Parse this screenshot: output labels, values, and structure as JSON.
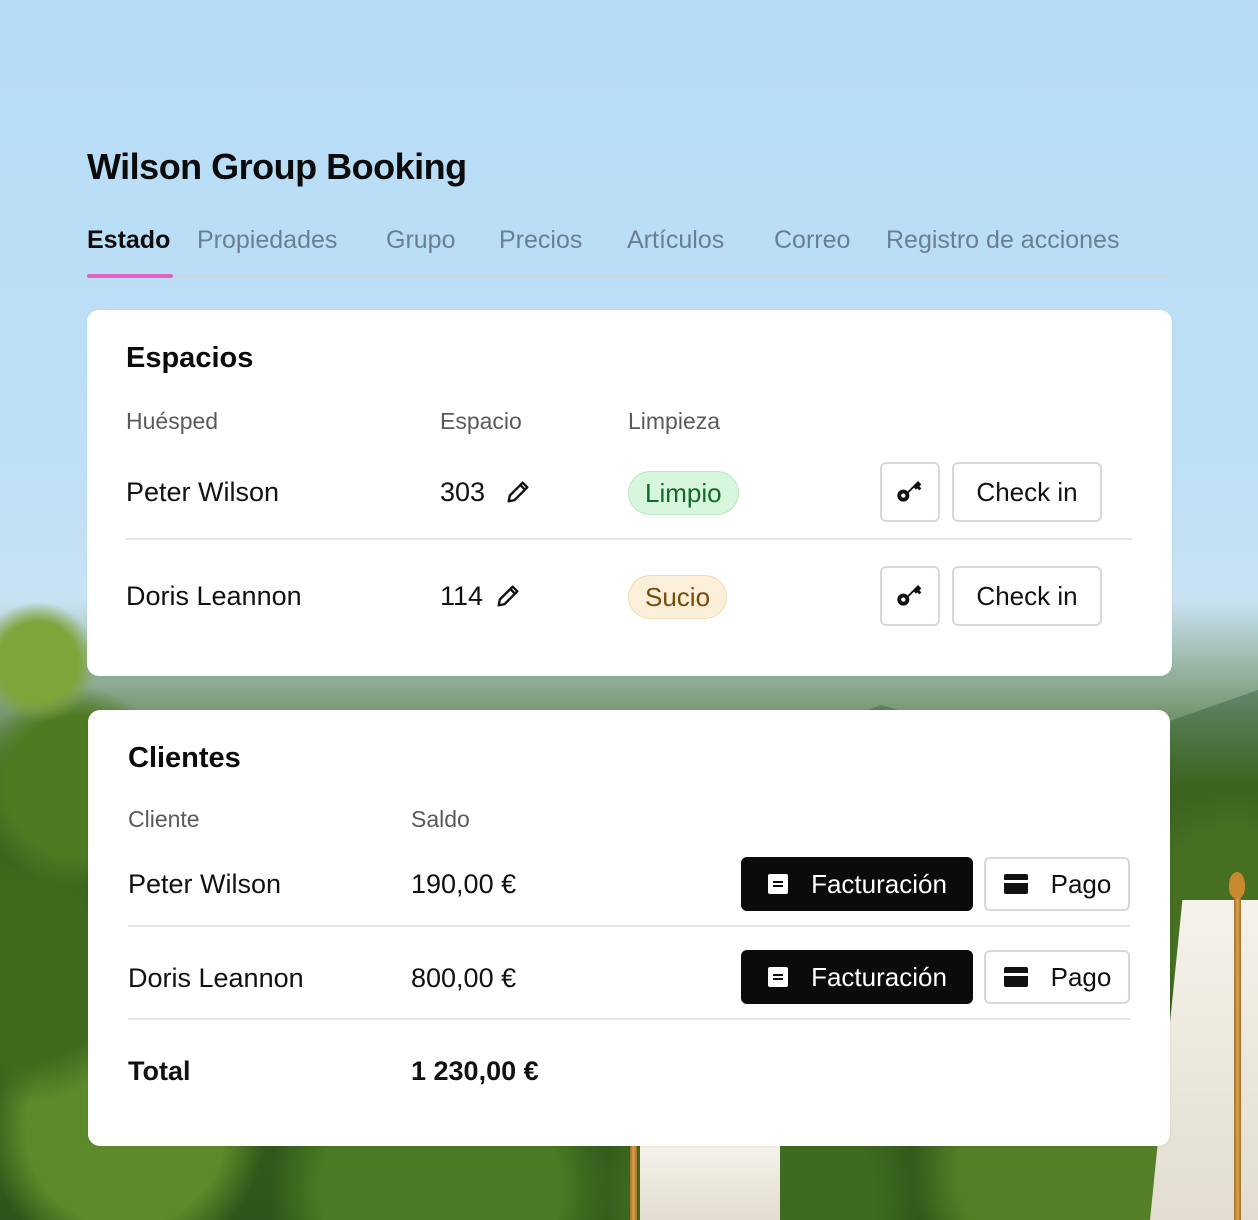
{
  "booking": {
    "title": "Wilson Group Booking"
  },
  "tabs": [
    {
      "label": "Estado",
      "active": true
    },
    {
      "label": "Propiedades"
    },
    {
      "label": "Grupo"
    },
    {
      "label": "Precios"
    },
    {
      "label": "Artículos"
    },
    {
      "label": "Correo"
    },
    {
      "label": "Registro de acciones"
    }
  ],
  "spaces": {
    "title": "Espacios",
    "columns": {
      "guest": "Huésped",
      "space": "Espacio",
      "cleaning": "Limpieza"
    },
    "rows": [
      {
        "guest": "Peter Wilson",
        "space": "303",
        "cleaning": "Limpio",
        "cleaning_status": "clean",
        "action": "Check in",
        "key_icon": "key-icon",
        "edit_icon": "pencil-icon"
      },
      {
        "guest": "Doris Leannon",
        "space": "114",
        "cleaning": "Sucio",
        "cleaning_status": "dirty",
        "action": "Check in",
        "key_icon": "key-icon",
        "edit_icon": "pencil-icon"
      }
    ]
  },
  "clients": {
    "title": "Clientes",
    "columns": {
      "client": "Cliente",
      "balance": "Saldo"
    },
    "rows": [
      {
        "client": "Peter Wilson",
        "balance": "190,00 €",
        "billing_label": "Facturación",
        "payment_label": "Pago"
      },
      {
        "client": "Doris Leannon",
        "balance": "800,00 €",
        "billing_label": "Facturación",
        "payment_label": "Pago"
      }
    ],
    "total": {
      "label": "Total",
      "value": "1 230,00 €"
    }
  },
  "colors": {
    "accent": "#e063c4",
    "clean_bg": "#d8f6dc",
    "clean_text": "#0f6b2a",
    "dirty_bg": "#fbefd9",
    "dirty_text": "#7a4a07",
    "dark_button": "#0b0b0b"
  }
}
